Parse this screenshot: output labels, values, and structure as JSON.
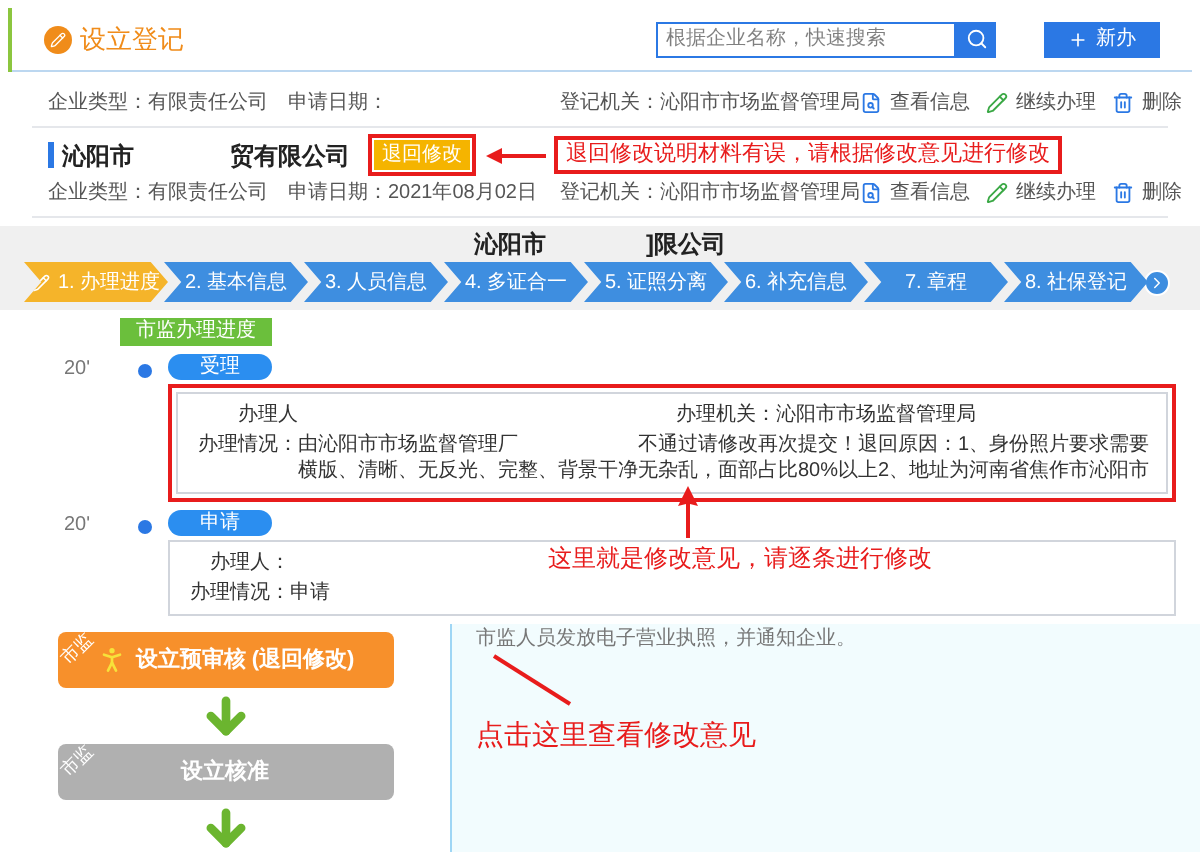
{
  "header": {
    "title": "设立登记",
    "search": {
      "placeholder": "根据企业名称，快速搜索"
    },
    "new_button": "新办"
  },
  "records": [
    {
      "meta": [
        "企业类型：有限责任公司",
        "申请日期：",
        "登记机关：沁阳市市场监督管理局"
      ],
      "actions": [
        "查看信息",
        "继续办理",
        "删除"
      ]
    },
    {
      "name_start": "沁阳市",
      "name_end": "贸有限公司",
      "badge": "退回修改",
      "meta": [
        "企业类型：有限责任公司",
        "申请日期：2021年08月02日",
        "登记机关：沁阳市市场监督管理局"
      ],
      "actions": [
        "查看信息",
        "继续办理",
        "删除"
      ]
    }
  ],
  "callout": "退回修改说明材料有误，请根据修改意见进行修改",
  "company_title": [
    "沁阳市",
    "]限公司"
  ],
  "steps": [
    {
      "label": "1. 办理进度",
      "selected": true
    },
    {
      "label": "2. 基本信息",
      "selected": false
    },
    {
      "label": "3. 人员信息",
      "selected": false
    },
    {
      "label": "4. 多证合一",
      "selected": false
    },
    {
      "label": "5. 证照分离",
      "selected": false
    },
    {
      "label": "6. 补充信息",
      "selected": false
    },
    {
      "label": "7. 章程",
      "selected": false
    },
    {
      "label": "8. 社保登记",
      "selected": false
    }
  ],
  "timeline": {
    "tag": "市监办理进度",
    "entries": [
      {
        "year": "20'",
        "stage": "受理",
        "highlighted": true,
        "fields": [
          {
            "label": "办理人"
          },
          {
            "label": "办理机关：",
            "value": "沁阳市市场监督管理局"
          },
          {
            "label": "办理情况：",
            "value": "由沁阳市市场监督管理厂　　　　　　不通过请修改再次提交！退回原因：1、身份照片要求需要横版、清晰、无反光、完整、背景干净无杂乱，面部占比80%以上2、地址为河南省焦作市沁阳市"
          }
        ]
      },
      {
        "year": "20'",
        "stage": "申请",
        "highlighted": false,
        "fields": [
          {
            "label": "办理人："
          },
          {
            "label": "办理情况：",
            "value": "申请"
          }
        ]
      }
    ],
    "note": "这里就是修改意见，请逐条进行修改"
  },
  "flow": [
    {
      "badge": "市监",
      "title": "设立预审核 (退回修改)",
      "kind": "active"
    },
    {
      "badge": "市监",
      "title": "设立核准",
      "kind": "pending"
    }
  ],
  "detail": {
    "text": "市监人员发放电子营业执照，并通知企业。",
    "note": "点击这里查看修改意见"
  }
}
